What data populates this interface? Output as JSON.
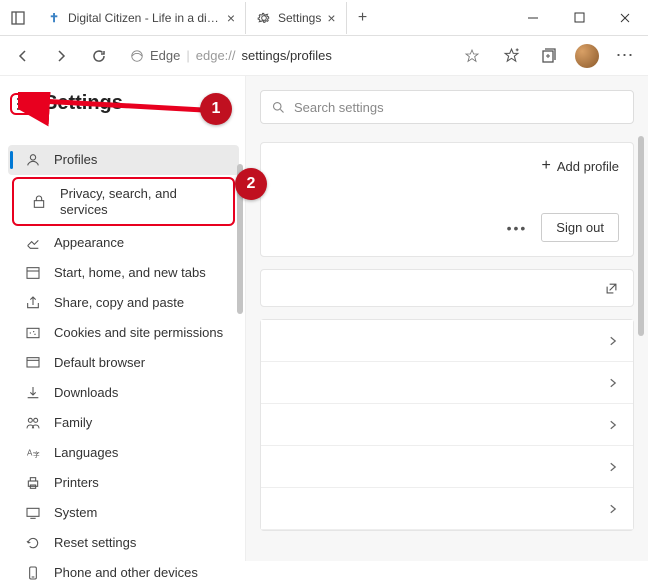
{
  "titlebar": {
    "tabs": [
      {
        "label": "Digital Citizen - Life in a digital w"
      },
      {
        "label": "Settings"
      }
    ]
  },
  "toolbar": {
    "address_prefix": "Edge",
    "address_host": "edge://",
    "address_path": "settings/profiles"
  },
  "settings": {
    "title": "Settings",
    "items": [
      "Profiles",
      "Privacy, search, and services",
      "Appearance",
      "Start, home, and new tabs",
      "Share, copy and paste",
      "Cookies and site permissions",
      "Default browser",
      "Downloads",
      "Family",
      "Languages",
      "Printers",
      "System",
      "Reset settings",
      "Phone and other devices"
    ]
  },
  "main": {
    "search_placeholder": "Search settings",
    "add_profile": "Add profile",
    "sign_out": "Sign out"
  },
  "annotations": {
    "step1": "1",
    "step2": "2"
  }
}
